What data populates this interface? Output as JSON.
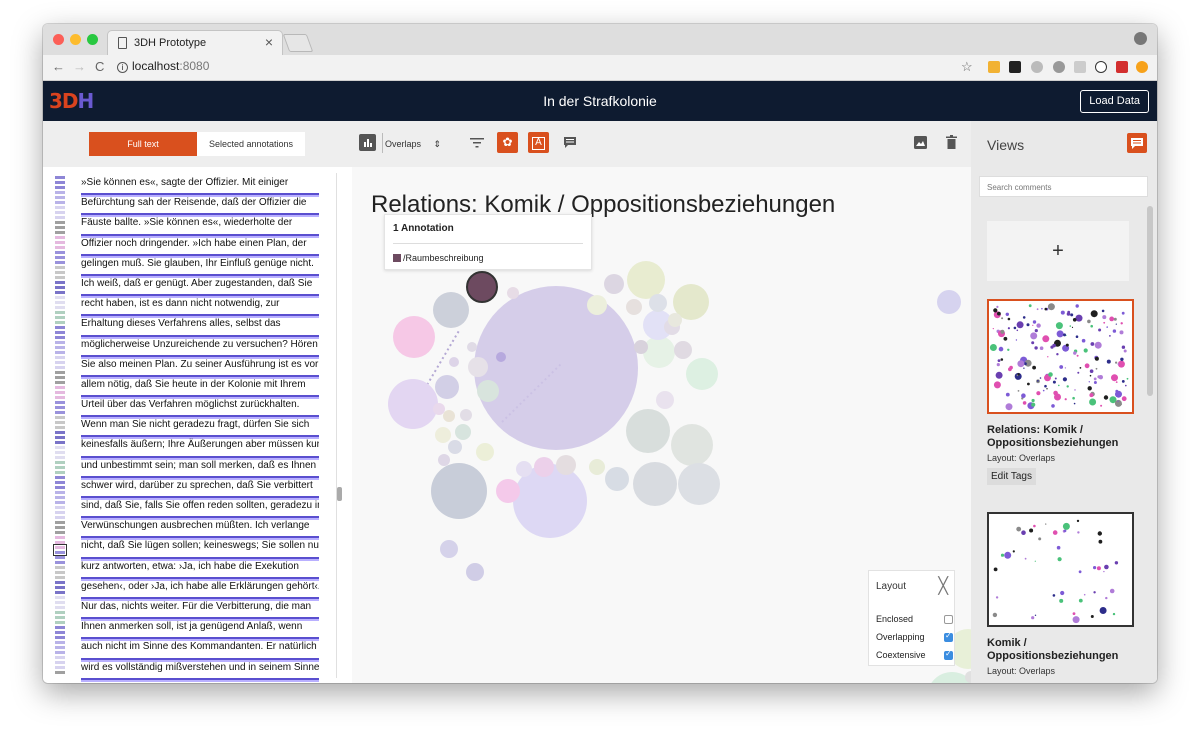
{
  "browser": {
    "tab_title": "3DH Prototype",
    "tab_close": "×",
    "url_host": "localhost",
    "url_port": ":8080",
    "nav_back": "←",
    "nav_forward": "→",
    "nav_reload": "C",
    "star": "☆"
  },
  "app": {
    "logo_main": "3D",
    "logo_h": "H",
    "title": "In der Strafkolonie",
    "load_button": "Load Data"
  },
  "toolbar": {
    "full_text": "Full text",
    "selected_annotations": "Selected annotations",
    "layout_select": "Overlaps",
    "select_arrows": "⇕",
    "settings_glyph": "✿",
    "annotate_glyph": "A"
  },
  "text": {
    "lines": [
      "»Sie können es«, sagte der Offizier. Mit einiger",
      "Befürchtung sah der Reisende, daß der Offizier die",
      "Fäuste ballte. »Sie können es«, wiederholte der",
      "Offizier noch dringender. »Ich habe einen Plan, der",
      "gelingen muß. Sie glauben, Ihr Einfluß genüge nicht.",
      "Ich weiß, daß er genügt. Aber zugestanden, daß Sie",
      "recht haben, ist es dann nicht notwendig, zur",
      "Erhaltung dieses Verfahrens alles, selbst das",
      "möglicherweise Unzureichende zu versuchen? Hören",
      "Sie also meinen Plan. Zu seiner Ausführung ist es vor",
      "allem nötig, daß Sie heute in der Kolonie mit Ihrem",
      "Urteil über das Verfahren möglichst zurückhalten.",
      "Wenn man Sie nicht geradezu fragt, dürfen Sie sich",
      "keinesfalls äußern; Ihre Äußerungen aber müssen kurz",
      "und unbestimmt sein; man soll merken, daß es Ihnen",
      "schwer wird, darüber zu sprechen, daß Sie verbittert",
      "sind, daß Sie, falls Sie offen reden sollten, geradezu in",
      "Verwünschungen ausbrechen müßten. Ich verlange",
      "nicht, daß Sie lügen sollen; keineswegs; Sie sollen nur",
      "kurz antworten, etwa: ›Ja, ich habe die Exekution",
      "gesehen‹, oder ›Ja, ich habe alle Erklärungen gehört‹.",
      "Nur das, nichts weiter. Für die Verbitterung, die man",
      "Ihnen anmerken soll, ist ja genügend Anlaß, wenn",
      "auch nicht im Sinne des Kommandanten. Er natürlich",
      "wird es vollständig mißverstehen und in seinem Sinne"
    ]
  },
  "visualization": {
    "title": "Relations: Komik / Oppositionsbeziehungen",
    "tooltip": {
      "header": "1 Annotation",
      "item": "/Raumbeschreibung",
      "item_color": "#6d4a60"
    },
    "layout_panel": {
      "title": "Layout",
      "close": "╳",
      "options": [
        {
          "label": "Enclosed",
          "checked": false
        },
        {
          "label": "Overlapping",
          "checked": true
        },
        {
          "label": "Coextensive",
          "checked": true
        }
      ]
    }
  },
  "views": {
    "header": "Views",
    "search_placeholder": "Search comments",
    "add_glyph": "+",
    "cards": [
      {
        "title": "Relations: Komik / Oppositionsbeziehungen",
        "layout": "Layout: Overlaps",
        "button": "Edit Tags",
        "selected": true
      },
      {
        "title": "Komik / Oppositionsbeziehungen",
        "layout": "Layout: Overlaps",
        "selected": false
      }
    ]
  },
  "colors": {
    "accent": "#d9501e",
    "header_bg": "#0e1b30",
    "underline": "#5a4fcf",
    "checkbox_on": "#3b8de0"
  }
}
